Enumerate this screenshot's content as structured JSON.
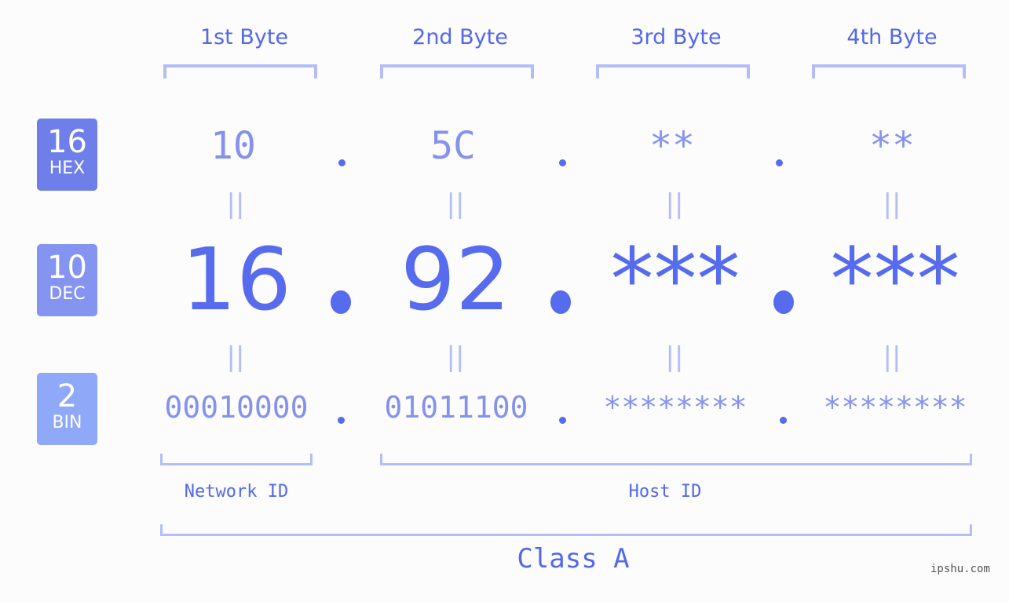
{
  "colors": {
    "hex_badge": "#6f7fe9",
    "dec_badge": "#8494f0",
    "bin_badge": "#8fa8f7",
    "accent": "#566bee",
    "bracket": "#b4bdf7",
    "muted_value": "#8592ed"
  },
  "badges": [
    {
      "number": "16",
      "label": "HEX"
    },
    {
      "number": "10",
      "label": "DEC"
    },
    {
      "number": "2",
      "label": "BIN"
    }
  ],
  "byte_headers": [
    "1st Byte",
    "2nd Byte",
    "3rd Byte",
    "4th Byte"
  ],
  "hex_values": [
    "10",
    "5C",
    "**",
    "**"
  ],
  "dec_values": [
    "16",
    "92",
    "***",
    "***"
  ],
  "bin_values": [
    "00010000",
    "01011100",
    "********",
    "********"
  ],
  "equals_symbol": "||",
  "network_label": "Network ID",
  "host_label": "Host ID",
  "class_label": "Class A",
  "watermark": "ipshu.com"
}
